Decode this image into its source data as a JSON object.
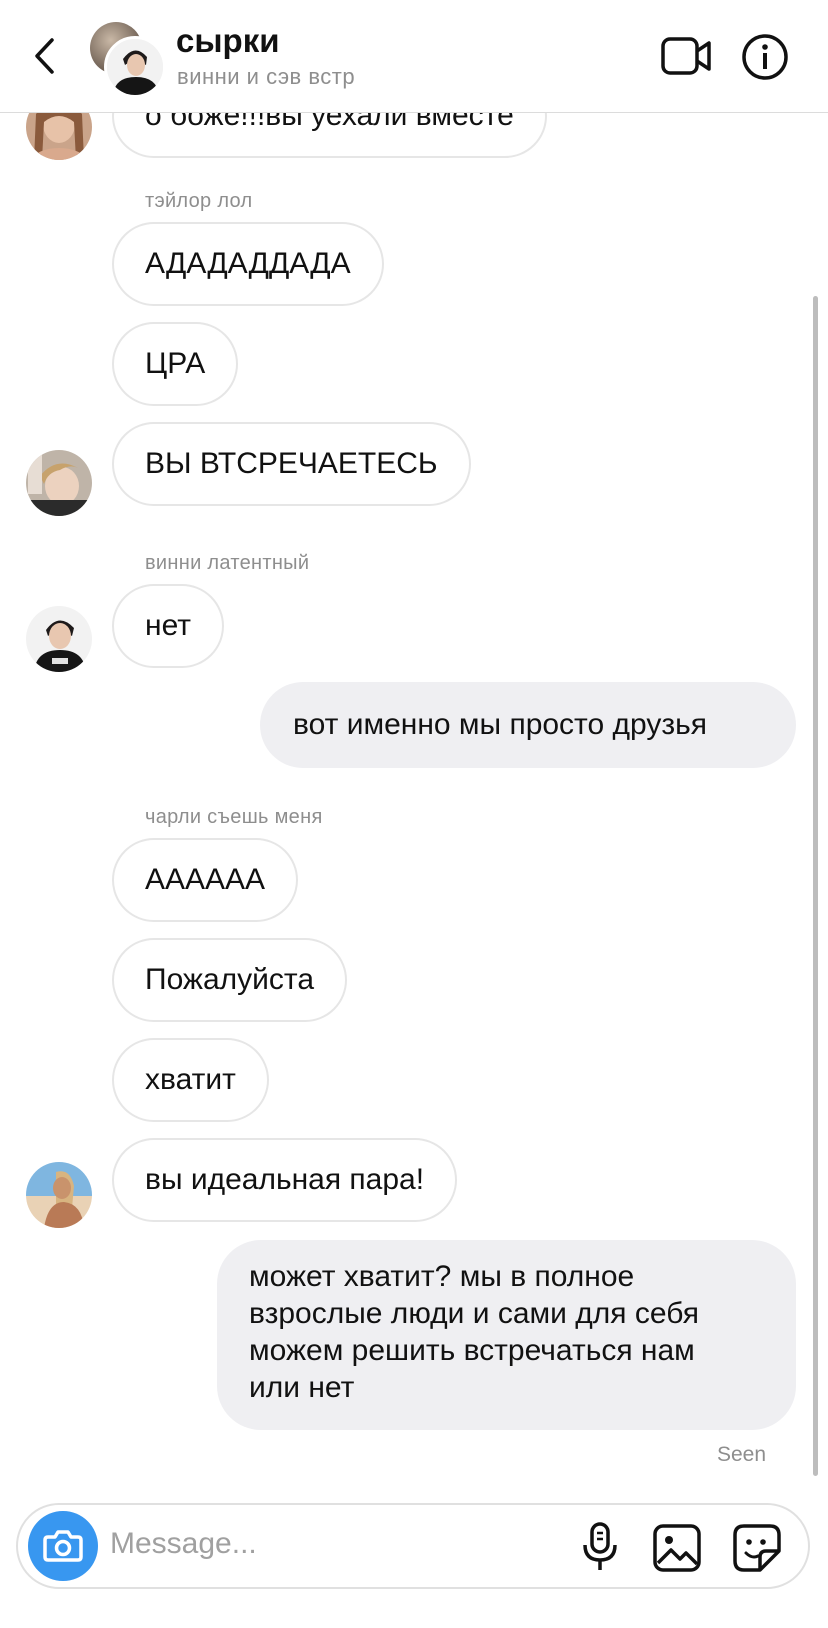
{
  "header": {
    "title": "сырки",
    "subtitle": "винни и сэв встр"
  },
  "messages": {
    "m0": "о боже!!!вы уехали вместе",
    "s1": "тэйлор лол",
    "m1": "АДАДАДДАДА",
    "m2": "ЦРА",
    "m3": "ВЫ ВТСРЕЧАЕТЕСЬ",
    "s2": "винни латентный",
    "m4": "нет",
    "m5": "вот именно мы просто друзья",
    "s3": "чарли съешь меня",
    "m6": "АААААА",
    "m7": "Пожалуйста",
    "m8": "хватит",
    "m9": "вы идеальная пара!",
    "m10_lines": [
      "может хватит? мы в полное",
      "взрослые люди и сами для себя",
      "можем решить встречаться нам",
      "или нет"
    ],
    "seen": "Seen"
  },
  "composer": {
    "placeholder": "Message..."
  },
  "icons": {
    "back": "chevron-left-icon",
    "video": "video-camera-icon",
    "info": "info-icon",
    "camera": "camera-icon",
    "mic": "microphone-icon",
    "gallery": "gallery-icon",
    "sticker": "sticker-icon"
  },
  "colors": {
    "accent": "#3897f0",
    "outgoing_bubble": "#efeff2",
    "incoming_border": "#e6e6e6",
    "secondary_text": "#8e8e8e"
  }
}
